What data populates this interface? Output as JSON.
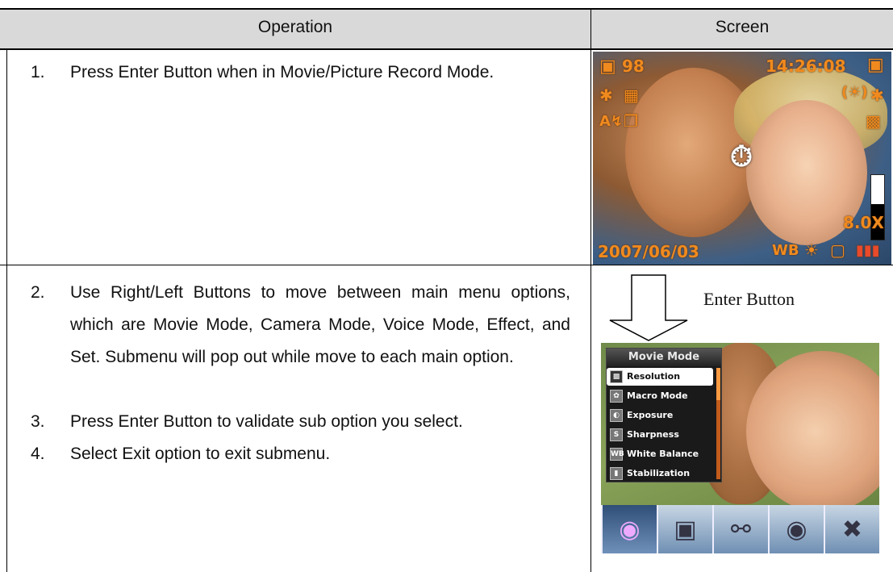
{
  "header": {
    "operation": "Operation",
    "screen": "Screen"
  },
  "steps": [
    {
      "num": "1.",
      "text": "Press Enter Button when in Movie/Picture Record Mode."
    },
    {
      "num": "2.",
      "text": "Use Right/Left Buttons to move between main menu options, which are Movie Mode, Camera Mode, Voice Mode, Effect, and Set. Submenu will pop out while move to each main option."
    },
    {
      "num": "3.",
      "text": "Press Enter Button to validate sub option you select."
    },
    {
      "num": "4.",
      "text": "Select Exit option to exit submenu."
    }
  ],
  "screen1": {
    "shots_left": "98",
    "time": "14:26:08",
    "zoom": "8.0X",
    "date": "2007/06/03",
    "wb": "WB",
    "zoom_level": 0.55
  },
  "arrow_label": "Enter Button",
  "screen2": {
    "menu_title": "Movie Mode",
    "items": [
      {
        "label": "Resolution",
        "icon": "resolution-icon",
        "selected": true
      },
      {
        "label": "Macro Mode",
        "icon": "macro-icon",
        "selected": false
      },
      {
        "label": "Exposure",
        "icon": "exposure-icon",
        "selected": false
      },
      {
        "label": "Sharpness",
        "icon": "sharpness-icon",
        "selected": false
      },
      {
        "label": "White Balance",
        "icon": "white-balance-icon",
        "selected": false
      },
      {
        "label": "Stabilization",
        "icon": "stabilization-icon",
        "selected": false
      }
    ],
    "tabs": [
      {
        "icon": "movie-reel-icon",
        "active": true
      },
      {
        "icon": "camera-icon",
        "active": false
      },
      {
        "icon": "microphone-icon",
        "active": false
      },
      {
        "icon": "palette-icon",
        "active": false
      },
      {
        "icon": "tools-icon",
        "active": false
      }
    ]
  }
}
